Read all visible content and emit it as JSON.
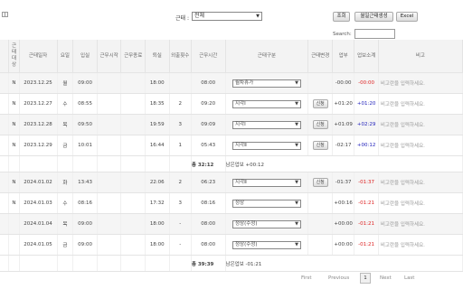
{
  "toolbar": {
    "filter_label": "근태 :",
    "filter_value": "전체",
    "btn_search": "조회",
    "btn_generate": "월일근태생성",
    "btn_excel": "Excel",
    "search_label": "Search:"
  },
  "table": {
    "headers": [
      "근태대상",
      "근태일자",
      "요일",
      "입실",
      "근무시작",
      "근무종료",
      "퇴실",
      "외출횟수",
      "근무시간",
      "근태구분",
      "근태변경",
      "업부",
      "업보소계",
      "비고"
    ],
    "rows": [
      {
        "flag": "N",
        "date": "2023.12.25",
        "day": "월",
        "in": "09:00",
        "start": "",
        "end": "",
        "out": "18:00",
        "cnt": "",
        "work": "08:00",
        "type": "월차휴가",
        "apply": "",
        "diff": "-00:00",
        "sub": "-00:00",
        "sub_color": "red",
        "memo": "비고란을 입력하세요.",
        "gray": true
      },
      {
        "flag": "N",
        "date": "2023.12.27",
        "day": "수",
        "in": "08:55",
        "start": "",
        "end": "",
        "out": "18:35",
        "cnt": "2",
        "work": "09:20",
        "type": "지각Ⅰ",
        "apply": "신청",
        "diff": "+01:20",
        "sub": "+01:20",
        "sub_color": "blue",
        "memo": "비고란을 입력하세요.",
        "gray": false
      },
      {
        "flag": "N",
        "date": "2023.12.28",
        "day": "목",
        "in": "09:50",
        "start": "",
        "end": "",
        "out": "19:59",
        "cnt": "3",
        "work": "09:09",
        "type": "지각Ⅰ",
        "apply": "신청",
        "diff": "+01:09",
        "sub": "+02:29",
        "sub_color": "blue",
        "memo": "비고란을 입력하세요.",
        "gray": true
      },
      {
        "flag": "N",
        "date": "2023.12.29",
        "day": "금",
        "in": "10:01",
        "start": "",
        "end": "",
        "out": "16:44",
        "cnt": "1",
        "work": "05:43",
        "type": "지각Ⅱ",
        "apply": "신청",
        "diff": "-02:17",
        "sub": "+00:12",
        "sub_color": "blue",
        "memo": "비고란을 입력하세요.",
        "gray": false
      },
      {
        "flag": "N",
        "date": "2024.01.02",
        "day": "화",
        "in": "13:43",
        "start": "",
        "end": "",
        "out": "22:06",
        "cnt": "2",
        "work": "06:23",
        "type": "지각Ⅱ",
        "apply": "신청",
        "diff": "-01:37",
        "sub": "-01:37",
        "sub_color": "red",
        "memo": "비고란을 입력하세요.",
        "gray": true
      },
      {
        "flag": "N",
        "date": "2024.01.03",
        "day": "수",
        "in": "08:16",
        "start": "",
        "end": "",
        "out": "17:32",
        "cnt": "3",
        "work": "08:16",
        "type": "정상",
        "apply": "",
        "diff": "+00:16",
        "sub": "-01:21",
        "sub_color": "red",
        "memo": "비고란을 입력하세요.",
        "gray": false
      },
      {
        "flag": "",
        "date": "2024.01.04",
        "day": "목",
        "in": "09:00",
        "start": "",
        "end": "",
        "out": "18:00",
        "cnt": "-",
        "work": "08:00",
        "type": "정상(수정)",
        "apply": "",
        "diff": "+00:00",
        "sub": "-01:21",
        "sub_color": "red",
        "memo": "비고란을 입력하세요.",
        "gray": true
      },
      {
        "flag": "",
        "date": "2024.01.05",
        "day": "금",
        "in": "09:00",
        "start": "",
        "end": "",
        "out": "18:00",
        "cnt": "-",
        "work": "08:00",
        "type": "정상(수정)",
        "apply": "",
        "diff": "+00:00",
        "sub": "-01:21",
        "sub_color": "red",
        "memo": "비고란을 입력하세요.",
        "gray": false
      }
    ],
    "summary1": {
      "total": "총 32:12",
      "remain": "남은업보 +00:12"
    },
    "summary2": {
      "total": "총 39:39",
      "remain": "남은업보 -01:21"
    }
  },
  "pager": {
    "first": "First",
    "prev": "Previous",
    "page": "1",
    "next": "Next",
    "last": "Last"
  },
  "colors": {
    "red": "#dd2222",
    "blue": "#2222bb",
    "header_bg": "#f3f3f3"
  }
}
